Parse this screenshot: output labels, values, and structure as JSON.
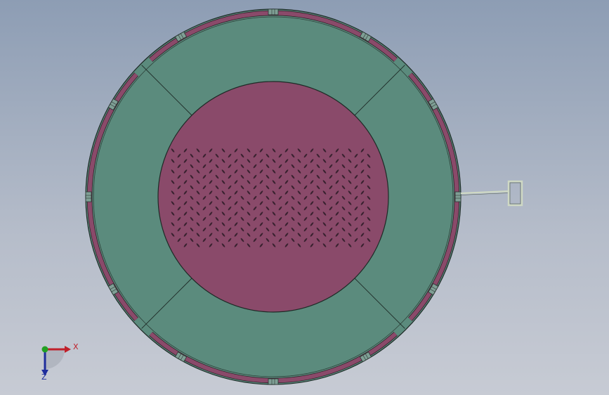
{
  "viewport": {
    "background_top": "#8d9db4",
    "background_bottom": "#c7cbd4"
  },
  "model": {
    "ring_color": "#5b8b7d",
    "core_color": "#8a4a6a",
    "rim_color": "#8a4a6a",
    "edge_color": "#1e2a26",
    "hole_color": "#3a2230",
    "handle_color": "#cfd9c4"
  },
  "triad": {
    "x_label": "X",
    "z_label": "Z",
    "x_color": "#c0202a",
    "y_color": "#22a022",
    "z_color": "#1e2d9c"
  }
}
